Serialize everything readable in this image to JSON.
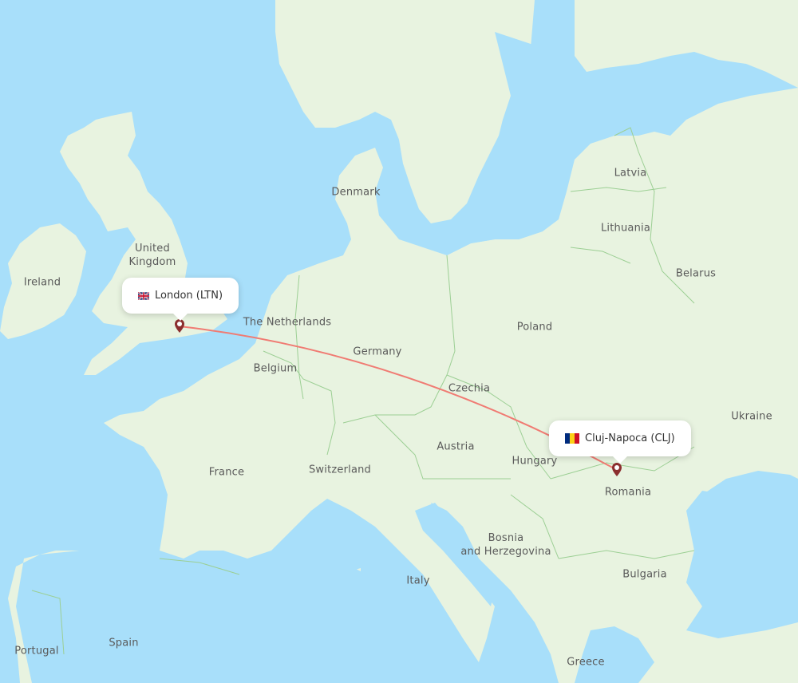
{
  "map": {
    "colors": {
      "water": "#a8dffa",
      "land": "#e8f3e0",
      "border": "#9ccf94",
      "route": "#f07b73",
      "marker": "#8b2e2e"
    },
    "country_labels": [
      {
        "name": "Ireland"
      },
      {
        "name": "United Kingdom",
        "line1": "United",
        "line2": "Kingdom"
      },
      {
        "name": "Denmark"
      },
      {
        "name": "The Netherlands"
      },
      {
        "name": "Belgium"
      },
      {
        "name": "Germany"
      },
      {
        "name": "Poland"
      },
      {
        "name": "Latvia"
      },
      {
        "name": "Lithuania"
      },
      {
        "name": "Belarus"
      },
      {
        "name": "Czechia"
      },
      {
        "name": "Ukraine"
      },
      {
        "name": "France"
      },
      {
        "name": "Switzerland"
      },
      {
        "name": "Austria"
      },
      {
        "name": "Hungary"
      },
      {
        "name": "Romania"
      },
      {
        "name": "Bosnia and Herzegovina",
        "line1": "Bosnia",
        "line2": "and Herzegovina"
      },
      {
        "name": "Italy"
      },
      {
        "name": "Bulgaria"
      },
      {
        "name": "Spain"
      },
      {
        "name": "Portugal"
      },
      {
        "name": "Greece"
      }
    ],
    "route": {
      "origin": {
        "city": "London",
        "code": "LTN",
        "label": "London (LTN)",
        "flag": "gb-flag-icon"
      },
      "destination": {
        "city": "Cluj-Napoca",
        "code": "CLJ",
        "label": "Cluj-Napoca (CLJ)",
        "flag": "ro-flag-icon"
      }
    }
  }
}
